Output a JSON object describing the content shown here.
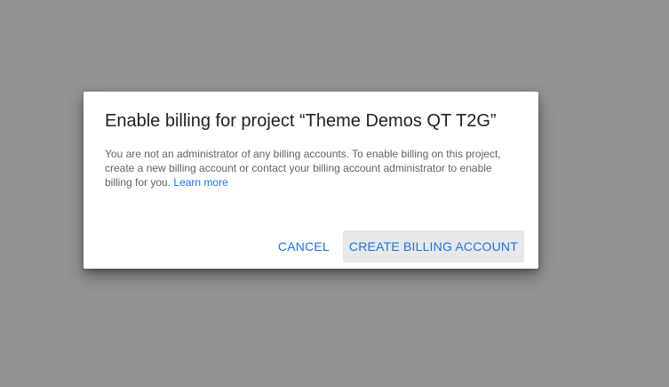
{
  "dialog": {
    "title": "Enable billing for project “Theme Demos QT T2G”",
    "message": "You are not an administrator of any billing accounts. To enable billing on this project, create a new billing account or contact your billing account administrator to enable billing for you.",
    "learn_more_label": "Learn more",
    "cancel_label": "CANCEL",
    "create_label": "CREATE BILLING ACCOUNT"
  },
  "colors": {
    "backdrop": "#929292",
    "accent": "#1a73e8",
    "primary_button_bg": "#e8e8e8"
  }
}
